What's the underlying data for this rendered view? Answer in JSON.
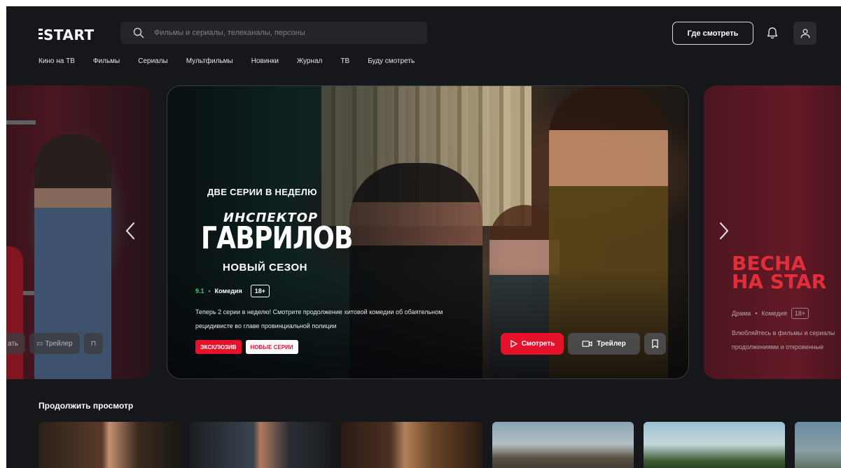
{
  "header": {
    "logo": "START",
    "search_placeholder": "Фильмы и сериалы, телеканалы, персоны",
    "where_to_watch": "Где смотреть"
  },
  "nav": [
    "Кино на ТВ",
    "Фильмы",
    "Сериалы",
    "Мультфильмы",
    "Новинки",
    "Журнал",
    "ТВ",
    "Буду смотреть"
  ],
  "left_card": {
    "watch_partial": "ать",
    "trailer": "Трейлер"
  },
  "promo": {
    "kicker": "ДВЕ СЕРИИ В НЕДЕЛЮ",
    "title_small": "ИНСПЕКТОР",
    "title_big": "ГАВРИЛОВ",
    "season": "НОВЫЙ СЕЗОН",
    "rating": "9.1",
    "genre": "Комедия",
    "age": "18+",
    "description_line1": "Теперь 2 серии в неделю! Смотрите продолжение хитовой комедии об обаятельном",
    "description_line2": "рецидивисте во главе провинциальной полиции",
    "badge_exclusive": "ЭКСКЛЮЗИВ",
    "badge_new_episodes": "НОВЫЕ СЕРИИ",
    "watch": "Смотреть",
    "trailer": "Трейлер"
  },
  "right_card": {
    "title": "ВЕСНА\nНА STAR",
    "genre1": "Драма",
    "genre2": "Комедия",
    "age": "18+",
    "description_line1": "Влюбляйтесь в фильмы и сериалы",
    "description_line2": "продолжениями и откровенные"
  },
  "continue": {
    "title": "Продолжить просмотр"
  },
  "colors": {
    "accent": "#e6122b",
    "rating": "#3ccf6e",
    "background": "#16171b"
  }
}
